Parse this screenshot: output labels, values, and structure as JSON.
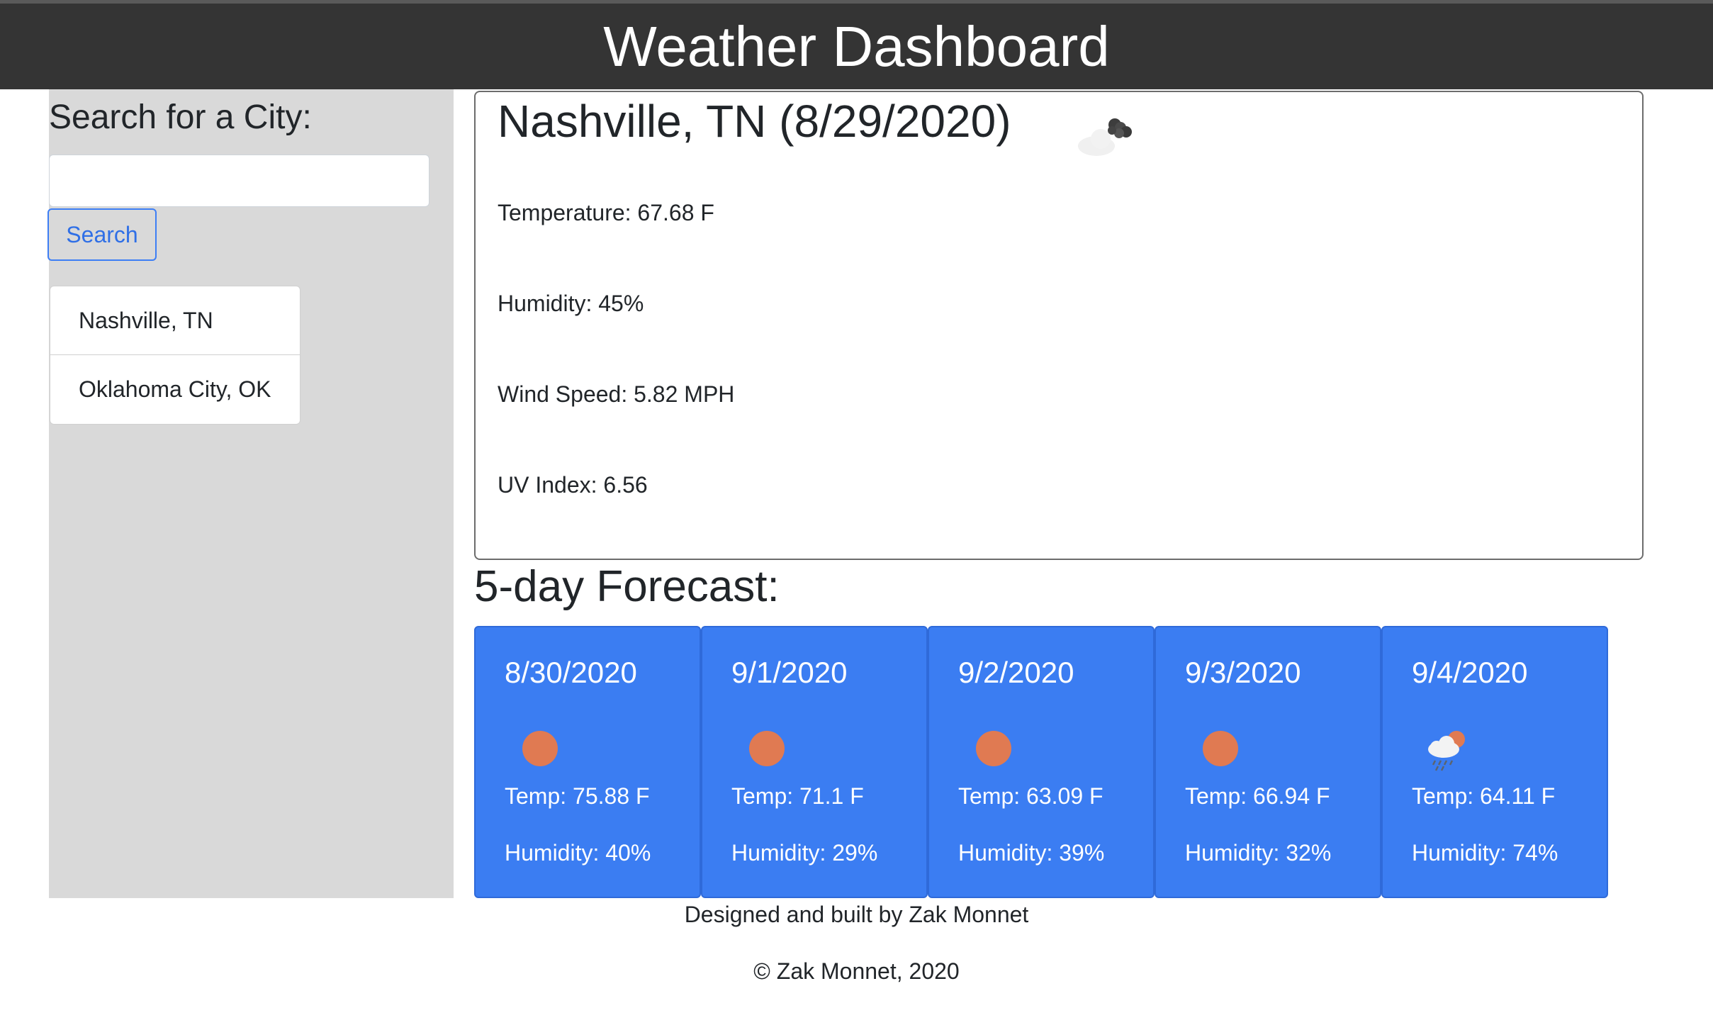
{
  "header": {
    "title": "Weather Dashboard"
  },
  "sidebar": {
    "search_label": "Search for a City:",
    "search_value": "",
    "search_button": "Search",
    "history": [
      "Nashville, TN",
      "Oklahoma City, OK"
    ]
  },
  "current": {
    "title": "Nashville, TN (8/29/2020)",
    "icon": "broken-clouds-icon",
    "temperature": "Temperature: 67.68 F",
    "humidity": "Humidity: 45%",
    "wind": "Wind Speed: 5.82 MPH",
    "uv": "UV Index: 6.56"
  },
  "forecast": {
    "title": "5-day Forecast:",
    "days": [
      {
        "date": "8/30/2020",
        "icon": "clear-sky-icon",
        "temp": "Temp: 75.88 F",
        "humidity": "Humidity: 40%"
      },
      {
        "date": "9/1/2020",
        "icon": "clear-sky-icon",
        "temp": "Temp: 71.1 F",
        "humidity": "Humidity: 29%"
      },
      {
        "date": "9/2/2020",
        "icon": "clear-sky-icon",
        "temp": "Temp: 63.09 F",
        "humidity": "Humidity: 39%"
      },
      {
        "date": "9/3/2020",
        "icon": "clear-sky-icon",
        "temp": "Temp: 66.94 F",
        "humidity": "Humidity: 32%"
      },
      {
        "date": "9/4/2020",
        "icon": "rain-icon",
        "temp": "Temp: 64.11 F",
        "humidity": "Humidity: 74%"
      }
    ]
  },
  "footer": {
    "credit": "Designed and built by Zak Monnet",
    "copyright": "© Zak Monnet, 2020"
  },
  "colors": {
    "header_bg": "#343434",
    "sidebar_bg": "#d9d9d9",
    "card_blue": "#3b7df2",
    "sun": "#e07a52",
    "link_blue": "#2f6fe6"
  }
}
